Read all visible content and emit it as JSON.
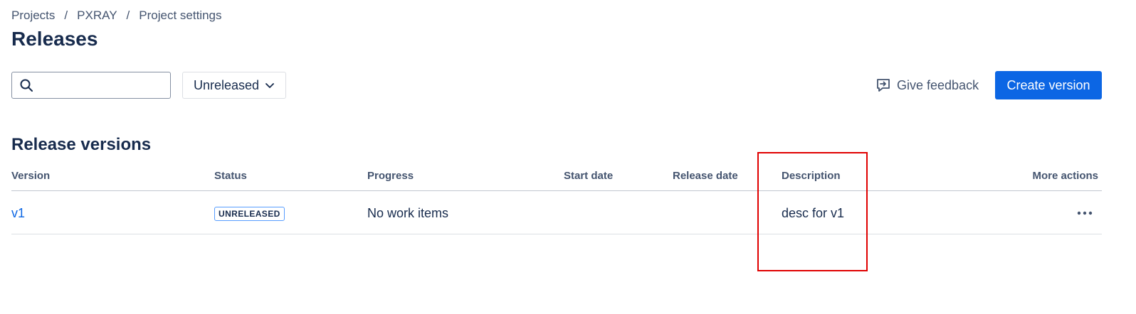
{
  "breadcrumb": {
    "items": [
      "Projects",
      "PXRAY",
      "Project settings"
    ],
    "separator": "/"
  },
  "page_title": "Releases",
  "search": {
    "value": "",
    "placeholder": ""
  },
  "filter": {
    "selected": "Unreleased"
  },
  "feedback_label": "Give feedback",
  "create_button_label": "Create version",
  "section_title": "Release versions",
  "table": {
    "columns": [
      "Version",
      "Status",
      "Progress",
      "Start date",
      "Release date",
      "Description",
      "More actions"
    ],
    "rows": [
      {
        "version": "v1",
        "status": "UNRELEASED",
        "progress": "No work items",
        "start_date": "",
        "release_date": "",
        "description": "desc for v1"
      }
    ]
  },
  "colors": {
    "primary": "#0c66e4",
    "highlight": "#e00000",
    "badge_border": "#579dff"
  },
  "icons": [
    "search-icon",
    "chevron-down-icon",
    "feedback-icon",
    "more-actions-icon"
  ]
}
